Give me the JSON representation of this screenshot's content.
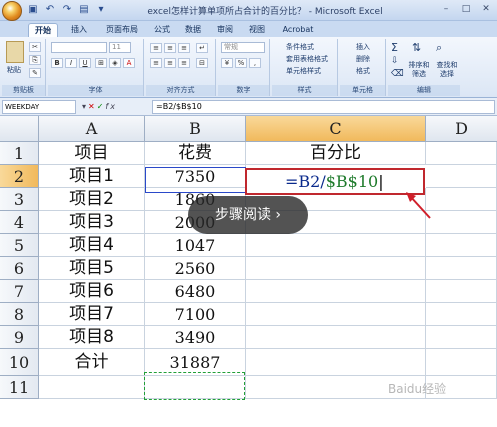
{
  "window": {
    "title": "excel怎样计算单项所占合计的百分比？ - Microsoft Excel"
  },
  "tabs": [
    {
      "label": "开始",
      "active": true
    },
    {
      "label": "插入",
      "active": false
    },
    {
      "label": "页面布局",
      "active": false
    },
    {
      "label": "公式",
      "active": false
    },
    {
      "label": "数据",
      "active": false
    },
    {
      "label": "审阅",
      "active": false
    },
    {
      "label": "视图",
      "active": false
    },
    {
      "label": "Acrobat",
      "active": false
    }
  ],
  "ribbon": {
    "groups": {
      "clipboard": "剪贴板",
      "font": "字体",
      "alignment": "对齐方式",
      "number": "数字",
      "styles": "样式",
      "cells": "单元格",
      "editing": "编辑"
    },
    "paste_label": "粘贴",
    "font_size": "11",
    "number_format": "常规",
    "styles_items": [
      "条件格式",
      "套用表格格式",
      "单元格样式"
    ],
    "cells_items": [
      "插入",
      "删除",
      "格式"
    ],
    "sort_filter": "排序和筛选",
    "find_select": "查找和选择"
  },
  "formula_bar": {
    "name_box": "WEEKDAY",
    "formula": "=B2/$B$10"
  },
  "columns": [
    "A",
    "B",
    "C",
    "D"
  ],
  "rows": [
    "1",
    "2",
    "3",
    "4",
    "5",
    "6",
    "7",
    "8",
    "9",
    "10",
    "11"
  ],
  "table": {
    "headers": [
      "项目",
      "花费",
      "百分比"
    ],
    "items": [
      {
        "name": "项目1",
        "cost": "7350"
      },
      {
        "name": "项目2",
        "cost": "1860"
      },
      {
        "name": "项目3",
        "cost": "2000"
      },
      {
        "name": "项目4",
        "cost": "1047"
      },
      {
        "name": "项目5",
        "cost": "2560"
      },
      {
        "name": "项目6",
        "cost": "6480"
      },
      {
        "name": "项目7",
        "cost": "7100"
      },
      {
        "name": "项目8",
        "cost": "3490"
      }
    ],
    "total": {
      "name": "合计",
      "cost": "31887"
    }
  },
  "editing_cell": {
    "prefix": "=B2/",
    "abs_ref": "$B$10"
  },
  "overlay": {
    "label": "步骤阅读 ›"
  },
  "watermark": "Baidu经验",
  "colors": {
    "edit_border": "#c0282e",
    "selected_header": "#f1b95c",
    "ref_blue": "#2a49c9",
    "ref_green": "#22a038"
  }
}
